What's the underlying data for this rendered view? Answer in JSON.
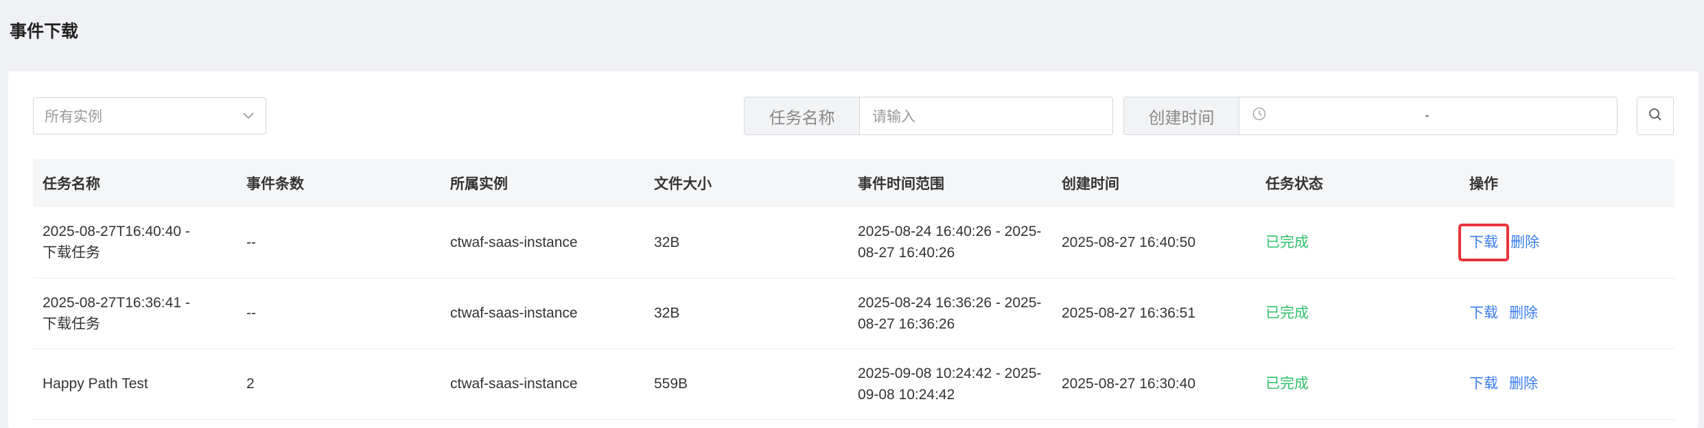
{
  "page": {
    "title": "事件下载"
  },
  "filters": {
    "instance_select": {
      "value": "所有实例",
      "icon": "chevron-down-icon"
    },
    "task_name": {
      "label": "任务名称",
      "placeholder": "请输入"
    },
    "create_time": {
      "label": "创建时间",
      "separator": "-",
      "icon": "clock-icon"
    },
    "search_icon": "search-icon"
  },
  "table": {
    "columns": [
      "任务名称",
      "事件条数",
      "所属实例",
      "文件大小",
      "事件时间范围",
      "创建时间",
      "任务状态",
      "操作"
    ],
    "rows": [
      {
        "name_line1": "2025-08-27T16:40:40 -",
        "name_line2": "下载任务",
        "count": "--",
        "instance": "ctwaf-saas-instance",
        "size": "32B",
        "range_line1": "2025-08-24 16:40:26 - 2025-",
        "range_line2": "08-27 16:40:26",
        "created": "2025-08-27 16:40:50",
        "status": "已完成",
        "download": "下载",
        "delete": "删除"
      },
      {
        "name_line1": "2025-08-27T16:36:41 -",
        "name_line2": "下载任务",
        "count": "--",
        "instance": "ctwaf-saas-instance",
        "size": "32B",
        "range_line1": "2025-08-24 16:36:26 - 2025-",
        "range_line2": "08-27 16:36:26",
        "created": "2025-08-27 16:36:51",
        "status": "已完成",
        "download": "下载",
        "delete": "删除"
      },
      {
        "name_line1": "Happy Path Test",
        "name_line2": "",
        "count": "2",
        "instance": "ctwaf-saas-instance",
        "size": "559B",
        "range_line1": "2025-09-08 10:24:42 - 2025-",
        "range_line2": "09-08 10:24:42",
        "created": "2025-08-27 16:30:40",
        "status": "已完成",
        "download": "下载",
        "delete": "删除"
      }
    ]
  },
  "colors": {
    "status_done": "#2fc06a",
    "link": "#3b7df0",
    "highlight_box": "#e8333a"
  }
}
